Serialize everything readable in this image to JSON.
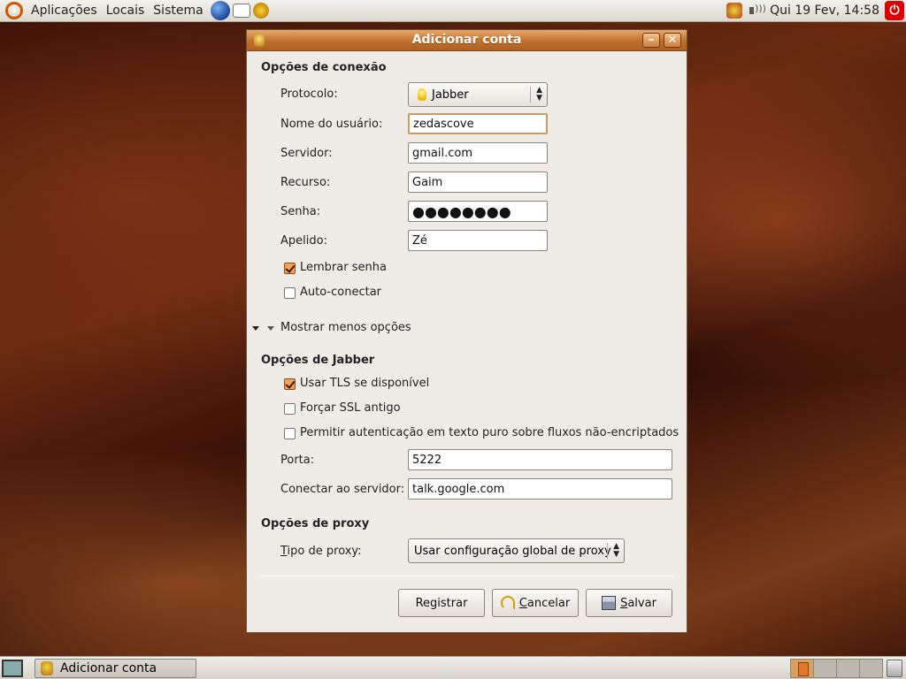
{
  "top_panel": {
    "menus": [
      "Aplicações",
      "Locais",
      "Sistema"
    ],
    "clock": "Qui 19 Fev, 14:58"
  },
  "dialog": {
    "title": "Adicionar conta",
    "connection": {
      "section_title": "Opções de conexão",
      "protocol_label": "Protocolo:",
      "protocol_value": "Jabber",
      "username_label": "Nome do usuário:",
      "username_value": "zedascove",
      "server_label": "Servidor:",
      "server_value": "gmail.com",
      "resource_label": "Recurso:",
      "resource_value": "Gaim",
      "password_label": "Senha:",
      "password_mask": "●●●●●●●●",
      "alias_label": "Apelido:",
      "alias_value": "Zé",
      "remember_password": {
        "label": "Lembrar senha",
        "checked": true
      },
      "auto_connect": {
        "label": "Auto-conectar",
        "checked": false
      }
    },
    "expander_label": "Mostrar menos opções",
    "jabber": {
      "section_title": "Opções de Jabber",
      "use_tls": {
        "label": "Usar TLS se disponível",
        "checked": true
      },
      "force_ssl": {
        "label": "Forçar SSL antigo",
        "checked": false
      },
      "plaintext_auth": {
        "label": "Permitir autenticação em texto puro sobre fluxos não-encriptados",
        "checked": false
      },
      "port_label": "Porta:",
      "port_value": "5222",
      "connect_server_label": "Conectar ao servidor:",
      "connect_server_value": "talk.google.com"
    },
    "proxy": {
      "section_title": "Opções de proxy",
      "type_label_underlined": "T",
      "type_label_rest": "ipo de proxy:",
      "type_value": "Usar configuração global de proxy"
    },
    "buttons": {
      "register": "Registrar",
      "cancel_underlined": "C",
      "cancel_rest": "ancelar",
      "save_underlined": "S",
      "save_rest": "alvar"
    }
  },
  "taskbar": {
    "task_label": "Adicionar conta"
  },
  "colors": {
    "titlebar_accent": "#c0702c",
    "checkbox_checked": "#f2a25a",
    "focus_border": "#d49a5a"
  }
}
